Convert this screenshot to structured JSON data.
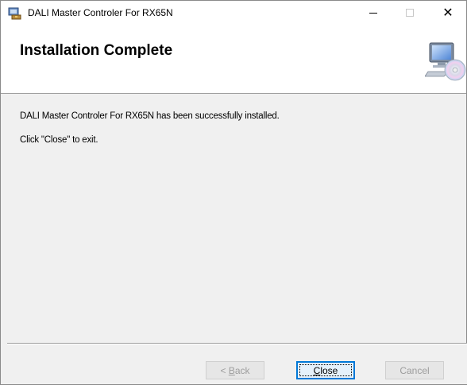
{
  "window": {
    "title": "DALI Master Controler For RX65N",
    "controls": {
      "minimize_icon": "minimize-icon",
      "maximize_icon": "maximize-icon",
      "close_glyph": "✕"
    }
  },
  "banner": {
    "title": "Installation Complete",
    "icon": "computer-cd-icon"
  },
  "content": {
    "message_line1": "DALI Master Controler For RX65N has been successfully installed.",
    "message_line2": "Click \"Close\" to exit."
  },
  "buttons": {
    "back": {
      "prefix": "< ",
      "mnemonic": "B",
      "rest": "ack",
      "enabled": false
    },
    "close": {
      "mnemonic": "C",
      "rest": "lose",
      "enabled": true,
      "focused": true
    },
    "cancel": {
      "label": "Cancel",
      "enabled": false
    }
  },
  "colors": {
    "accent": "#0078d7",
    "dialog_bg": "#f0f0f0",
    "disabled_text": "#9d9d9d"
  }
}
